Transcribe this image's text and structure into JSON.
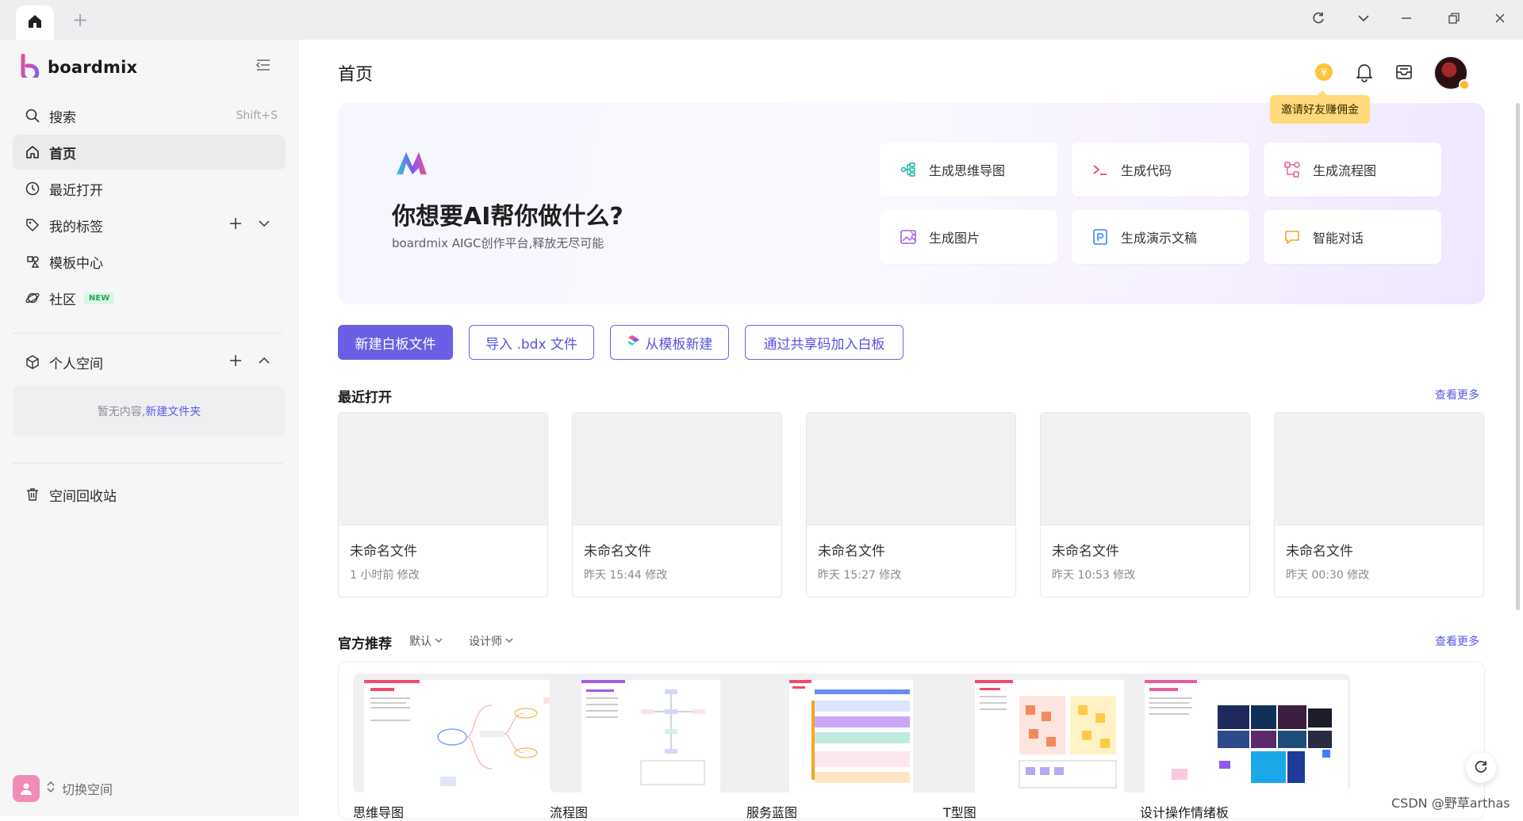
{
  "app": {
    "name": "boardmix"
  },
  "window": {
    "tab_add": "+"
  },
  "sidebar": {
    "search_label": "搜索",
    "search_shortcut": "Shift+S",
    "items": [
      {
        "label": "首页",
        "icon": "home-icon"
      },
      {
        "label": "最近打开",
        "icon": "clock-icon"
      },
      {
        "label": "我的标签",
        "icon": "tag-icon"
      },
      {
        "label": "模板中心",
        "icon": "template-icon"
      },
      {
        "label": "社区",
        "icon": "planet-icon",
        "badge": "NEW"
      }
    ],
    "personal_space": "个人空间",
    "empty_text": "暂无内容,",
    "empty_link": "新建文件夹",
    "trash": "空间回收站",
    "switch_space": "切换空间"
  },
  "header": {
    "title": "首页",
    "invite_tip": "邀请好友赚佣金"
  },
  "ai": {
    "title": "你想要AI帮你做什么?",
    "subtitle": "boardmix AIGC创作平台,释放无尽可能",
    "cards": [
      {
        "label": "生成思维导图",
        "icon": "mindmap-icon",
        "color": "#1fb8a8"
      },
      {
        "label": "生成代码",
        "icon": "code-icon",
        "color": "#f04c6a"
      },
      {
        "label": "生成流程图",
        "icon": "flowchart-icon",
        "color": "#e85aa0"
      },
      {
        "label": "生成图片",
        "icon": "image-icon",
        "color": "#a85ce0"
      },
      {
        "label": "生成演示文稿",
        "icon": "presentation-icon",
        "color": "#3b82f6"
      },
      {
        "label": "智能对话",
        "icon": "chat-icon",
        "color": "#f5a623"
      }
    ]
  },
  "actions": {
    "new_board": "新建白板文件",
    "import_bdx": "导入 .bdx 文件",
    "from_template": "从模板新建",
    "join_by_code": "通过共享码加入白板"
  },
  "recent": {
    "title": "最近打开",
    "see_more": "查看更多",
    "files": [
      {
        "name": "未命名文件",
        "time": "1 小时前 修改"
      },
      {
        "name": "未命名文件",
        "time": "昨天 15:44 修改"
      },
      {
        "name": "未命名文件",
        "time": "昨天 15:27 修改"
      },
      {
        "name": "未命名文件",
        "time": "昨天 10:53 修改"
      },
      {
        "name": "未命名文件",
        "time": "昨天 00:30 修改"
      }
    ]
  },
  "official": {
    "title": "官方推荐",
    "filter_sort": "默认",
    "filter_role": "设计师",
    "see_more": "查看更多",
    "templates": [
      {
        "name": "思维导图"
      },
      {
        "name": "流程图"
      },
      {
        "name": "服务蓝图"
      },
      {
        "name": "T型图"
      },
      {
        "name": "设计操作情绪板"
      }
    ]
  },
  "watermark": "CSDN @野草arthas",
  "colors": {
    "accent": "#6a5fe4",
    "link": "#5a58e6"
  }
}
